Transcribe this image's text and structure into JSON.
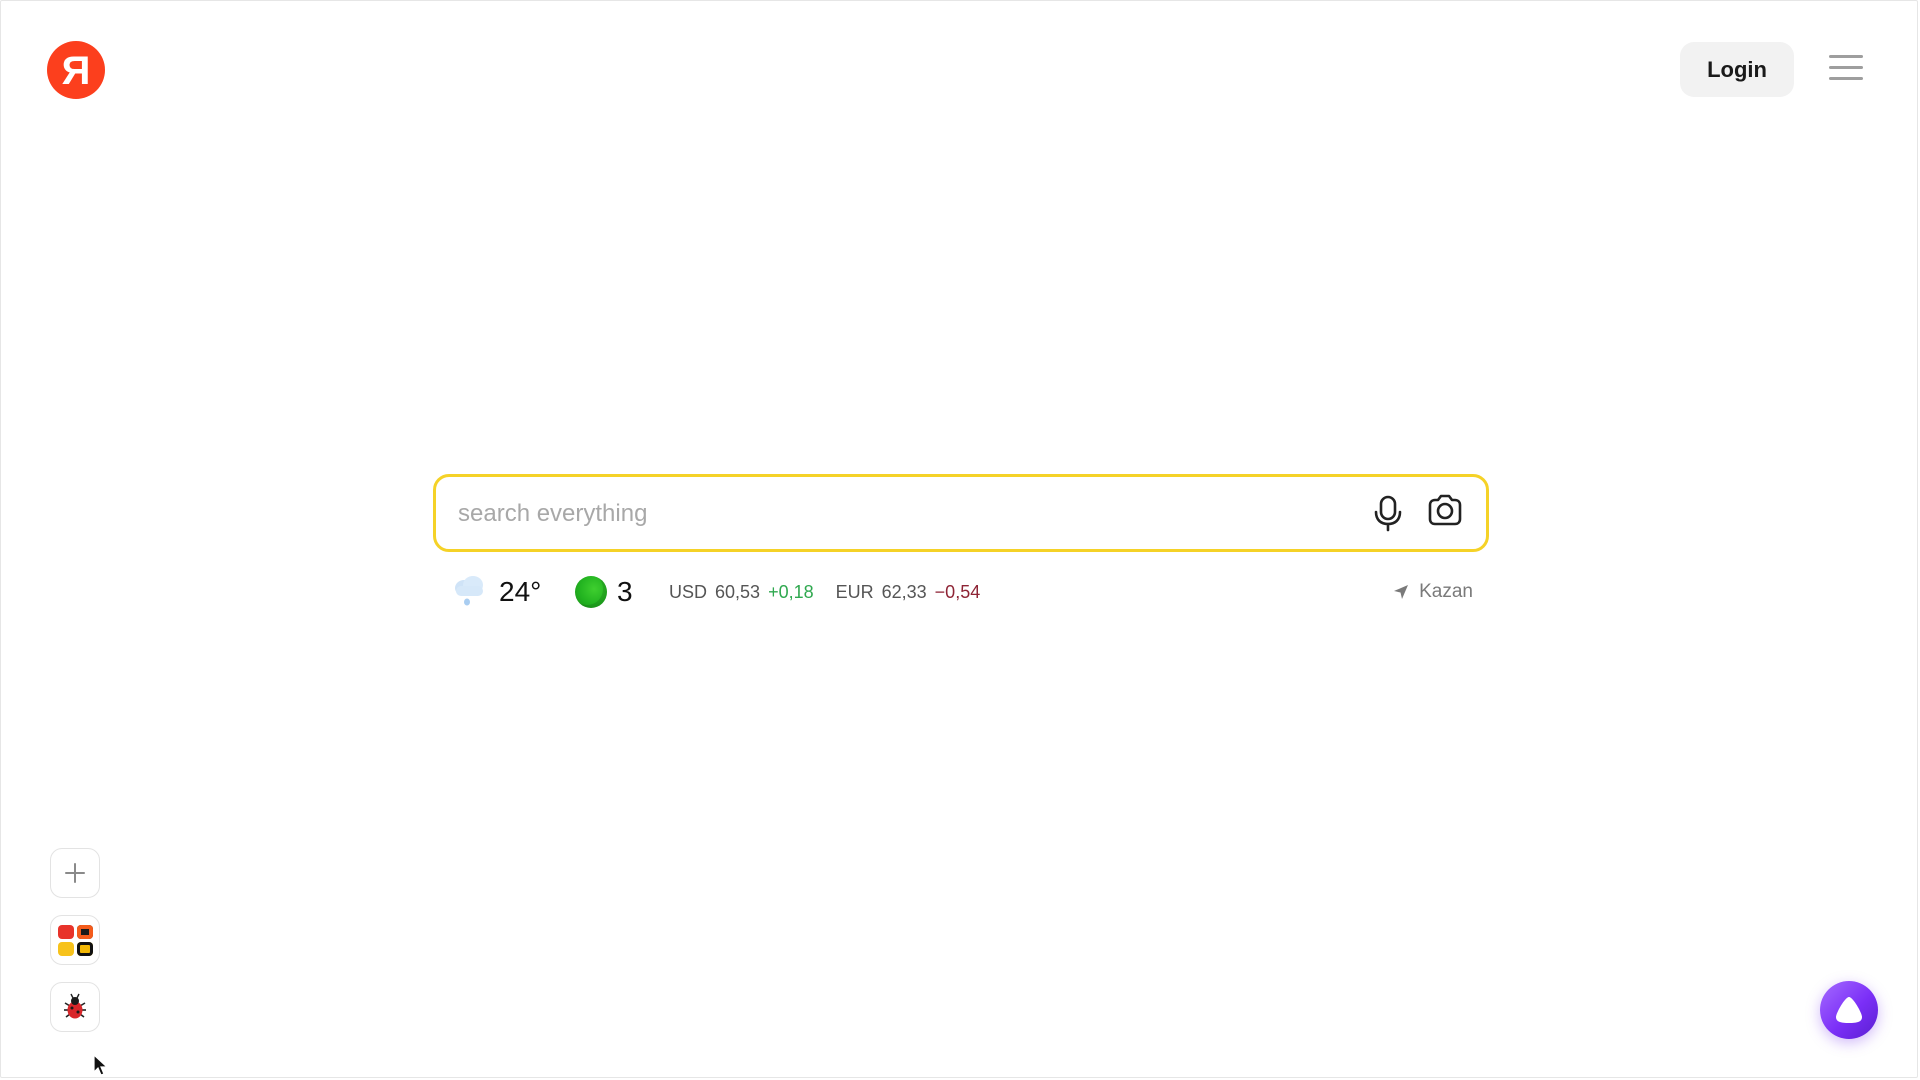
{
  "header": {
    "logo_letter": "Я",
    "login_label": "Login",
    "menu_icon": "hamburger-menu-icon"
  },
  "search": {
    "placeholder": "search everything",
    "value": "",
    "border_color": "#f5d227",
    "mic_icon": "microphone-icon",
    "camera_icon": "camera-search-icon"
  },
  "informers": {
    "weather": {
      "icon": "cloud-rain-icon",
      "temperature": "24°"
    },
    "traffic": {
      "icon": "traffic-level-icon",
      "score": "3",
      "color": "#22b320"
    },
    "rates": [
      {
        "currency": "USD",
        "value": "60,53",
        "change": "+0,18",
        "direction": "up",
        "color": "#2fa84f"
      },
      {
        "currency": "EUR",
        "value": "62,33",
        "change": "−0,54",
        "direction": "down",
        "color": "#8e2435"
      }
    ],
    "location": {
      "icon": "location-arrow-icon",
      "city": "Kazan"
    }
  },
  "side_buttons": {
    "add_icon": "plus-icon",
    "apps_icon": "apps-grid-icon",
    "bug_icon": "ladybug-icon"
  },
  "assistant": {
    "icon": "alice-assistant-icon",
    "color": "#7b2ff7"
  },
  "colors": {
    "brand_red": "#fc3f1d",
    "accent_yellow": "#f5d227"
  }
}
